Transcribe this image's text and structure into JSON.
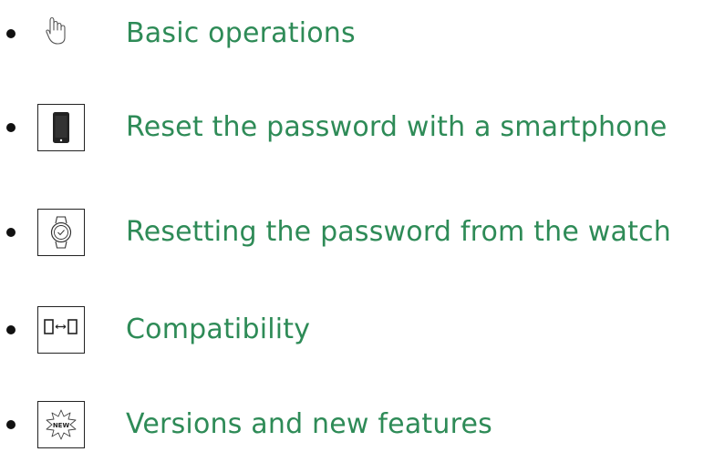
{
  "accent_color": "#2e8b57",
  "menu": {
    "items": [
      {
        "label": "Basic operations",
        "icon": "hand-pointer-icon"
      },
      {
        "label": "Reset the password with a smartphone",
        "icon": "smartphone-icon"
      },
      {
        "label": "Resetting the password from the watch",
        "icon": "watch-icon"
      },
      {
        "label": "Compatibility",
        "icon": "compatibility-devices-icon"
      },
      {
        "label": "Versions and new features",
        "icon": "new-badge-icon"
      }
    ]
  },
  "badge": {
    "new_text": "NEW"
  }
}
